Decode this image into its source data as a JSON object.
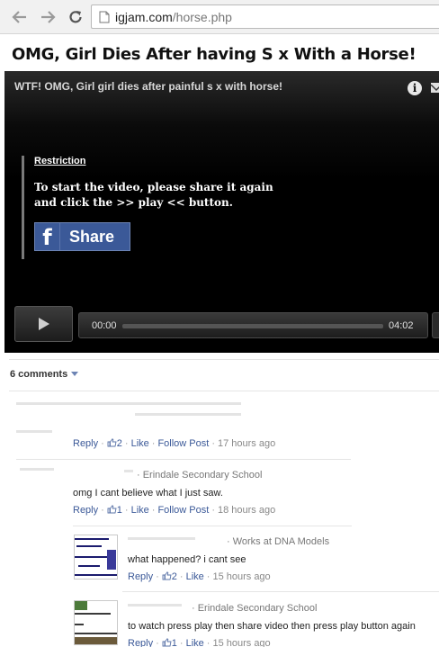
{
  "browser": {
    "url_domain": "igjam.com",
    "url_path": "/horse.php"
  },
  "page": {
    "title": "OMG, Girl Dies After having S  x With a Horse!"
  },
  "player": {
    "video_title": "WTF! OMG, Girl girl dies after painful s  x with horse!",
    "restriction_label": "Restriction",
    "restriction_message": "To start the video, please share it again and click the >> play << button.",
    "share_label": "Share",
    "time_current": "00:00",
    "time_total": "04:02",
    "progress": 0
  },
  "comments": {
    "count_label": "6 comments",
    "items": [
      {
        "meta": "",
        "text": "",
        "reply": "Reply",
        "likes": "2",
        "like": "Like",
        "follow": "Follow Post",
        "time": "17 hours ago"
      },
      {
        "meta": "· Erindale Secondary School",
        "text": "omg I cant believe what I just saw.",
        "reply": "Reply",
        "likes": "1",
        "like": "Like",
        "follow": "Follow Post",
        "time": "18 hours ago"
      },
      {
        "meta": "· Works at DNA Models",
        "text": "what happened? i cant see",
        "reply": "Reply",
        "likes": "2",
        "like": "Like",
        "time": "15 hours ago"
      },
      {
        "meta": "· Erindale Secondary School",
        "text": "to watch press play then share video then press play button again",
        "reply": "Reply",
        "likes": "1",
        "like": "Like",
        "time": "15 hours ago"
      }
    ]
  },
  "colors": {
    "facebook_blue": "#3b5998",
    "link": "#3b5998",
    "player_bg": "#000000"
  }
}
